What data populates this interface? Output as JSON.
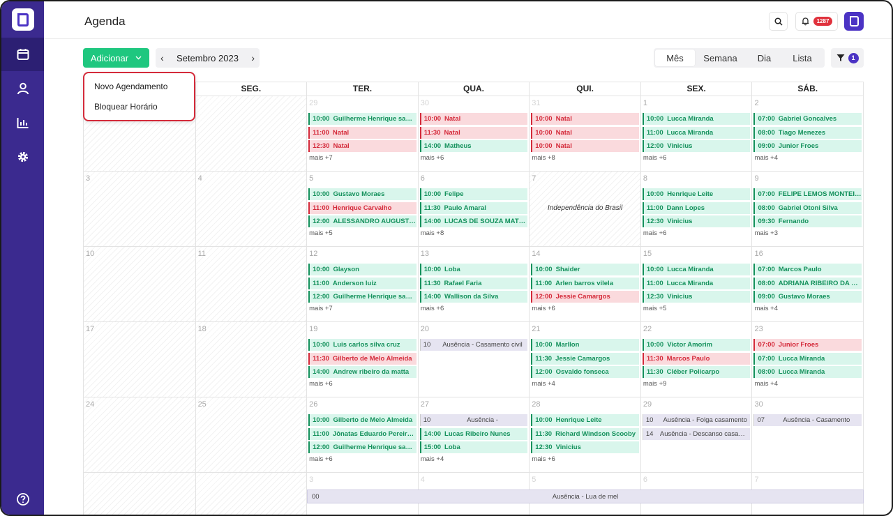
{
  "header": {
    "title": "Agenda",
    "notifications_count": "1287"
  },
  "toolbar": {
    "add_label": "Adicionar",
    "month_label": "Setembro 2023",
    "views": [
      "Mês",
      "Semana",
      "Dia",
      "Lista"
    ],
    "active_view": "Mês",
    "filter_count": "1"
  },
  "dropdown": {
    "items": [
      "Novo Agendamento",
      "Bloquear Horário"
    ]
  },
  "calendar": {
    "weekdays": [
      "",
      "SEG.",
      "TER.",
      "QUA.",
      "QUI.",
      "SEX.",
      "SÁB."
    ],
    "weeks": [
      {
        "days": [
          {
            "num": "",
            "hatched": true,
            "events": []
          },
          {
            "num": "",
            "hatched": true,
            "events": []
          },
          {
            "num": "29",
            "faded": true,
            "events": [
              {
                "time": "10:00",
                "name": "Guilherme Henrique santos",
                "color": "green"
              },
              {
                "time": "11:00",
                "name": "Natal",
                "color": "red"
              },
              {
                "time": "12:30",
                "name": "Natal",
                "color": "red"
              }
            ],
            "more": "mais +7"
          },
          {
            "num": "30",
            "faded": true,
            "events": [
              {
                "time": "10:00",
                "name": "Natal",
                "color": "red"
              },
              {
                "time": "11:30",
                "name": "Natal",
                "color": "red"
              },
              {
                "time": "14:00",
                "name": "Matheus",
                "color": "green"
              }
            ],
            "more": "mais +6"
          },
          {
            "num": "31",
            "faded": true,
            "events": [
              {
                "time": "10:00",
                "name": "Natal",
                "color": "red"
              },
              {
                "time": "10:00",
                "name": "Natal",
                "color": "red"
              },
              {
                "time": "10:00",
                "name": "Natal",
                "color": "red"
              }
            ],
            "more": "mais +8"
          },
          {
            "num": "1",
            "events": [
              {
                "time": "10:00",
                "name": "Lucca Miranda",
                "color": "green"
              },
              {
                "time": "11:00",
                "name": "Lucca Miranda",
                "color": "green"
              },
              {
                "time": "12:00",
                "name": "Vinicius",
                "color": "green"
              }
            ],
            "more": "mais +6"
          },
          {
            "num": "2",
            "events": [
              {
                "time": "07:00",
                "name": "Gabriel Goncalves",
                "color": "green"
              },
              {
                "time": "08:00",
                "name": "Tiago Menezes",
                "color": "green"
              },
              {
                "time": "09:00",
                "name": "Junior Froes",
                "color": "green"
              }
            ],
            "more": "mais +4"
          }
        ]
      },
      {
        "days": [
          {
            "num": "3",
            "hatched": true,
            "events": []
          },
          {
            "num": "4",
            "hatched": true,
            "events": []
          },
          {
            "num": "5",
            "events": [
              {
                "time": "10:00",
                "name": "Gustavo Moraes",
                "color": "green"
              },
              {
                "time": "11:00",
                "name": "Henrique Carvalho",
                "color": "red"
              },
              {
                "time": "12:00",
                "name": "ALESSANDRO AUGUSTO ...",
                "color": "green"
              }
            ],
            "more": "mais +5"
          },
          {
            "num": "6",
            "events": [
              {
                "time": "10:00",
                "name": "Felipe",
                "color": "green"
              },
              {
                "time": "11:30",
                "name": "Paulo Amaral",
                "color": "green"
              },
              {
                "time": "14:00",
                "name": "LUCAS DE SOUZA MATTOS",
                "color": "green"
              }
            ],
            "more": "mais +8"
          },
          {
            "num": "7",
            "hatched": true,
            "holiday": "Independência do Brasil",
            "events": []
          },
          {
            "num": "8",
            "events": [
              {
                "time": "10:00",
                "name": "Henrique Leite",
                "color": "green"
              },
              {
                "time": "11:00",
                "name": "Dann Lopes",
                "color": "green"
              },
              {
                "time": "12:30",
                "name": "Vinicius",
                "color": "green"
              }
            ],
            "more": "mais +6"
          },
          {
            "num": "9",
            "events": [
              {
                "time": "07:00",
                "name": "FELIPE LEMOS MONTEIRO",
                "color": "green"
              },
              {
                "time": "08:00",
                "name": "Gabriel Otoni Silva",
                "color": "green"
              },
              {
                "time": "09:30",
                "name": "Fernando",
                "color": "green"
              }
            ],
            "more": "mais +3"
          }
        ]
      },
      {
        "days": [
          {
            "num": "10",
            "hatched": true,
            "events": []
          },
          {
            "num": "11",
            "hatched": true,
            "events": []
          },
          {
            "num": "12",
            "events": [
              {
                "time": "10:00",
                "name": "Glayson",
                "color": "green"
              },
              {
                "time": "11:00",
                "name": "Anderson luiz",
                "color": "green"
              },
              {
                "time": "12:00",
                "name": "Guilherme Henrique santos",
                "color": "green"
              }
            ],
            "more": "mais +7"
          },
          {
            "num": "13",
            "events": [
              {
                "time": "10:00",
                "name": "Loba",
                "color": "green"
              },
              {
                "time": "11:30",
                "name": "Rafael Faria",
                "color": "green"
              },
              {
                "time": "14:00",
                "name": "Wallison da Silva",
                "color": "green"
              }
            ],
            "more": "mais +6"
          },
          {
            "num": "14",
            "events": [
              {
                "time": "10:00",
                "name": "Shaider",
                "color": "green"
              },
              {
                "time": "11:00",
                "name": "Arlen barros vilela",
                "color": "green"
              },
              {
                "time": "12:00",
                "name": "Jessie Camargos",
                "color": "red"
              }
            ],
            "more": "mais +6"
          },
          {
            "num": "15",
            "events": [
              {
                "time": "10:00",
                "name": "Lucca Miranda",
                "color": "green"
              },
              {
                "time": "11:00",
                "name": "Lucca Miranda",
                "color": "green"
              },
              {
                "time": "12:30",
                "name": "Vinicius",
                "color": "green"
              }
            ],
            "more": "mais +5"
          },
          {
            "num": "16",
            "events": [
              {
                "time": "07:00",
                "name": "Marcos Paulo",
                "color": "green"
              },
              {
                "time": "08:00",
                "name": "ADRIANA RIBEIRO DA MA...",
                "color": "green"
              },
              {
                "time": "09:00",
                "name": "Gustavo Moraes",
                "color": "green"
              }
            ],
            "more": "mais +4"
          }
        ]
      },
      {
        "days": [
          {
            "num": "17",
            "hatched": true,
            "events": []
          },
          {
            "num": "18",
            "hatched": true,
            "events": []
          },
          {
            "num": "19",
            "events": [
              {
                "time": "10:00",
                "name": "Luis carlos silva cruz",
                "color": "green"
              },
              {
                "time": "11:30",
                "name": "Gilberto de Melo Almeida",
                "color": "red"
              },
              {
                "time": "14:00",
                "name": "Andrew ribeiro da matta",
                "color": "green"
              }
            ],
            "more": "mais +6"
          },
          {
            "num": "20",
            "events": [
              {
                "time": "10",
                "name": "Ausência - Casamento civil",
                "color": "absence"
              }
            ]
          },
          {
            "num": "21",
            "events": [
              {
                "time": "10:00",
                "name": "Marllon",
                "color": "green"
              },
              {
                "time": "11:30",
                "name": "Jessie Camargos",
                "color": "green"
              },
              {
                "time": "12:00",
                "name": "Osvaldo fonseca",
                "color": "green"
              }
            ],
            "more": "mais +4"
          },
          {
            "num": "22",
            "events": [
              {
                "time": "10:00",
                "name": "Victor Amorim",
                "color": "green"
              },
              {
                "time": "11:30",
                "name": "Marcos Paulo",
                "color": "red"
              },
              {
                "time": "11:30",
                "name": "Cléber Policarpo",
                "color": "green"
              }
            ],
            "more": "mais +9"
          },
          {
            "num": "23",
            "events": [
              {
                "time": "07:00",
                "name": "Junior Froes",
                "color": "red"
              },
              {
                "time": "07:00",
                "name": "Lucca Miranda",
                "color": "green"
              },
              {
                "time": "08:00",
                "name": "Lucca Miranda",
                "color": "green"
              }
            ],
            "more": "mais +4"
          }
        ]
      },
      {
        "days": [
          {
            "num": "24",
            "hatched": true,
            "events": []
          },
          {
            "num": "25",
            "hatched": true,
            "events": []
          },
          {
            "num": "26",
            "events": [
              {
                "time": "10:00",
                "name": "Gilberto de Melo Almeida",
                "color": "green"
              },
              {
                "time": "11:00",
                "name": "Jônatas Eduardo Pereira ...",
                "color": "green"
              },
              {
                "time": "12:00",
                "name": "Guilherme Henrique santos",
                "color": "green"
              }
            ],
            "more": "mais +6"
          },
          {
            "num": "27",
            "events": [
              {
                "time": "10",
                "name": "Ausência -",
                "color": "absence"
              },
              {
                "time": "14:00",
                "name": "Lucas Ribeiro Nunes",
                "color": "green"
              },
              {
                "time": "15:00",
                "name": "Loba",
                "color": "green"
              }
            ],
            "more": "mais +4"
          },
          {
            "num": "28",
            "events": [
              {
                "time": "10:00",
                "name": "Henrique Leite",
                "color": "green"
              },
              {
                "time": "11:30",
                "name": "Richard Windson Scooby",
                "color": "green"
              },
              {
                "time": "12:30",
                "name": "Vinicius",
                "color": "green"
              }
            ],
            "more": "mais +6"
          },
          {
            "num": "29",
            "events": [
              {
                "time": "10",
                "name": "Ausência - Folga casamento",
                "color": "absence"
              },
              {
                "time": "14",
                "name": "Ausência - Descanso casamento",
                "color": "absence"
              }
            ]
          },
          {
            "num": "30",
            "events": [
              {
                "time": "07",
                "name": "Ausência - Casamento",
                "color": "absence"
              }
            ]
          }
        ]
      },
      {
        "days": [
          {
            "num": "",
            "hatched": true,
            "events": []
          },
          {
            "num": "",
            "hatched": true,
            "events": []
          },
          {
            "num": "3",
            "faded": true,
            "events": []
          },
          {
            "num": "4",
            "faded": true,
            "events": []
          },
          {
            "num": "5",
            "faded": true,
            "events": []
          },
          {
            "num": "6",
            "faded": true,
            "events": []
          },
          {
            "num": "7",
            "faded": true,
            "events": []
          }
        ]
      }
    ],
    "span_event": {
      "time": "00",
      "name": "Ausência - Lua de mel"
    }
  }
}
